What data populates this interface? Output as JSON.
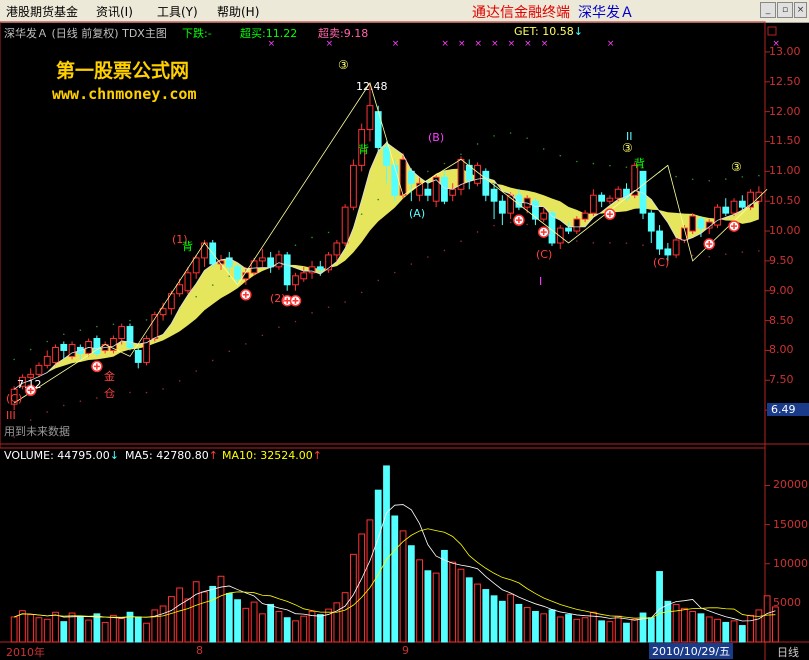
{
  "menu": {
    "items": [
      "港股期货基金",
      "资讯(I)",
      "工具(Y)",
      "帮助(H)"
    ],
    "terminal_name": "通达信金融终端",
    "stock_title": "深华发Ａ"
  },
  "header": {
    "stock": "深华发Ａ",
    "period": "(日线 前复权)",
    "indicator": "TDX主图",
    "xia_die_label": "下跌:",
    "xia_die_value": "-",
    "chao_mai_label": "超买:",
    "chao_mai_value": "11.22",
    "chao_mai2_label": "超卖:",
    "chao_mai2_value": "9.18",
    "get_label": "GET:",
    "get_value": "10.58"
  },
  "watermark": {
    "site_name": "第一股票公式网",
    "site_url": "www.chnmoney.com"
  },
  "price_axis": [
    "13.00",
    "12.50",
    "12.00",
    "11.50",
    "11.00",
    "10.50",
    "10.00",
    "9.50",
    "9.00",
    "8.50",
    "8.00",
    "7.50",
    "7.00"
  ],
  "current_price_tag": "6.49",
  "annotations": {
    "peak_value": "12.48",
    "low_value": "7.12",
    "circle3": "③",
    "wave_1": "(1)",
    "wave_2": "(2)",
    "wave_A": "(A)",
    "wave_B": "(B)",
    "wave_C": "(C)",
    "wave_I": "I",
    "wave_II": "II",
    "wave_III": "III",
    "bei": "背",
    "jin": "金",
    "cang": "仓",
    "future_data": "用到未来数据"
  },
  "volume_header": {
    "volume_label": "VOLUME:",
    "volume_value": "44795.00",
    "ma5_label": "MA5:",
    "ma5_value": "42780.80",
    "ma10_label": "MA10:",
    "ma10_value": "32524.00"
  },
  "volume_axis": [
    "20000",
    "15000",
    "10000",
    "5000"
  ],
  "date_axis": {
    "year": "2010年",
    "m8": "8",
    "m9": "9",
    "current_date": "2010/10/29/五",
    "period_tab": "日线"
  },
  "colors": {
    "up": "#ff3232",
    "down": "#54ffff",
    "ma5": "#ffffff",
    "ma10": "#ffff00",
    "band": "#ffff66",
    "axis": "#b22222"
  },
  "chart_data": {
    "type": "candlestick",
    "candles": [
      {
        "o": 7.1,
        "c": 7.35,
        "h": 7.4,
        "l": 7.0
      },
      {
        "o": 7.4,
        "c": 7.55,
        "h": 7.6,
        "l": 7.35
      },
      {
        "o": 7.55,
        "c": 7.6,
        "h": 7.7,
        "l": 7.5
      },
      {
        "o": 7.6,
        "c": 7.75,
        "h": 7.8,
        "l": 7.55
      },
      {
        "o": 7.75,
        "c": 7.9,
        "h": 8.0,
        "l": 7.7
      },
      {
        "o": 7.8,
        "c": 8.05,
        "h": 8.1,
        "l": 7.75
      },
      {
        "o": 8.1,
        "c": 8.0,
        "h": 8.15,
        "l": 7.85
      },
      {
        "o": 7.9,
        "c": 8.1,
        "h": 8.15,
        "l": 7.85
      },
      {
        "o": 8.05,
        "c": 7.95,
        "h": 8.1,
        "l": 7.85
      },
      {
        "o": 7.95,
        "c": 8.15,
        "h": 8.2,
        "l": 7.9
      },
      {
        "o": 8.2,
        "c": 7.95,
        "h": 8.25,
        "l": 7.9
      },
      {
        "o": 8.0,
        "c": 8.1,
        "h": 8.15,
        "l": 7.95
      },
      {
        "o": 8.0,
        "c": 8.2,
        "h": 8.25,
        "l": 7.95
      },
      {
        "o": 8.2,
        "c": 8.4,
        "h": 8.45,
        "l": 8.1
      },
      {
        "o": 8.4,
        "c": 8.05,
        "h": 8.45,
        "l": 8.0
      },
      {
        "o": 8.0,
        "c": 7.8,
        "h": 8.05,
        "l": 7.7
      },
      {
        "o": 7.8,
        "c": 8.2,
        "h": 8.25,
        "l": 7.75
      },
      {
        "o": 8.2,
        "c": 8.6,
        "h": 8.65,
        "l": 8.15
      },
      {
        "o": 8.6,
        "c": 8.7,
        "h": 8.8,
        "l": 8.5
      },
      {
        "o": 8.7,
        "c": 8.95,
        "h": 9.0,
        "l": 8.6
      },
      {
        "o": 8.95,
        "c": 9.1,
        "h": 9.2,
        "l": 8.9
      },
      {
        "o": 9.0,
        "c": 9.3,
        "h": 9.4,
        "l": 8.95
      },
      {
        "o": 9.3,
        "c": 9.55,
        "h": 9.6,
        "l": 9.2
      },
      {
        "o": 9.55,
        "c": 9.8,
        "h": 9.85,
        "l": 9.4
      },
      {
        "o": 9.8,
        "c": 9.45,
        "h": 9.85,
        "l": 9.4
      },
      {
        "o": 9.45,
        "c": 9.5,
        "h": 9.6,
        "l": 9.35
      },
      {
        "o": 9.55,
        "c": 9.4,
        "h": 9.65,
        "l": 9.3
      },
      {
        "o": 9.4,
        "c": 9.2,
        "h": 9.45,
        "l": 9.1
      },
      {
        "o": 9.2,
        "c": 9.3,
        "h": 9.4,
        "l": 9.1
      },
      {
        "o": 9.3,
        "c": 9.5,
        "h": 9.55,
        "l": 9.25
      },
      {
        "o": 9.5,
        "c": 9.55,
        "h": 9.7,
        "l": 9.4
      },
      {
        "o": 9.55,
        "c": 9.4,
        "h": 9.65,
        "l": 9.3
      },
      {
        "o": 9.4,
        "c": 9.6,
        "h": 9.65,
        "l": 9.35
      },
      {
        "o": 9.6,
        "c": 9.1,
        "h": 9.65,
        "l": 9.0
      },
      {
        "o": 9.1,
        "c": 9.25,
        "h": 9.3,
        "l": 9.0
      },
      {
        "o": 9.2,
        "c": 9.3,
        "h": 9.4,
        "l": 9.15
      },
      {
        "o": 9.3,
        "c": 9.4,
        "h": 9.5,
        "l": 9.2
      },
      {
        "o": 9.4,
        "c": 9.35,
        "h": 9.5,
        "l": 9.25
      },
      {
        "o": 9.35,
        "c": 9.6,
        "h": 9.65,
        "l": 9.3
      },
      {
        "o": 9.6,
        "c": 9.8,
        "h": 9.85,
        "l": 9.5
      },
      {
        "o": 9.8,
        "c": 10.4,
        "h": 10.45,
        "l": 9.75
      },
      {
        "o": 10.4,
        "c": 11.1,
        "h": 11.2,
        "l": 10.35
      },
      {
        "o": 11.1,
        "c": 11.7,
        "h": 11.8,
        "l": 11.0
      },
      {
        "o": 11.7,
        "c": 12.1,
        "h": 12.48,
        "l": 11.5
      },
      {
        "o": 12.0,
        "c": 11.4,
        "h": 12.1,
        "l": 11.3
      },
      {
        "o": 11.4,
        "c": 11.1,
        "h": 11.5,
        "l": 10.8
      },
      {
        "o": 11.1,
        "c": 10.6,
        "h": 11.2,
        "l": 10.5
      },
      {
        "o": 10.6,
        "c": 11.2,
        "h": 11.3,
        "l": 10.55
      },
      {
        "o": 11.0,
        "c": 10.8,
        "h": 11.05,
        "l": 10.5
      },
      {
        "o": 10.6,
        "c": 10.8,
        "h": 10.9,
        "l": 10.5
      },
      {
        "o": 10.7,
        "c": 10.6,
        "h": 10.85,
        "l": 10.5
      },
      {
        "o": 10.5,
        "c": 10.9,
        "h": 10.95,
        "l": 10.4
      },
      {
        "o": 10.9,
        "c": 10.5,
        "h": 11.0,
        "l": 10.45
      },
      {
        "o": 10.6,
        "c": 10.7,
        "h": 10.8,
        "l": 10.5
      },
      {
        "o": 10.7,
        "c": 11.2,
        "h": 11.25,
        "l": 10.6
      },
      {
        "o": 11.1,
        "c": 10.85,
        "h": 11.2,
        "l": 10.7
      },
      {
        "o": 10.8,
        "c": 11.1,
        "h": 11.15,
        "l": 10.75
      },
      {
        "o": 11.0,
        "c": 10.6,
        "h": 11.05,
        "l": 10.5
      },
      {
        "o": 10.7,
        "c": 10.5,
        "h": 10.8,
        "l": 10.2
      },
      {
        "o": 10.5,
        "c": 10.3,
        "h": 10.6,
        "l": 10.1
      },
      {
        "o": 10.3,
        "c": 10.6,
        "h": 10.65,
        "l": 10.2
      },
      {
        "o": 10.6,
        "c": 10.4,
        "h": 10.7,
        "l": 10.35
      },
      {
        "o": 10.4,
        "c": 10.55,
        "h": 10.6,
        "l": 10.3
      },
      {
        "o": 10.5,
        "c": 10.2,
        "h": 10.55,
        "l": 10.1
      },
      {
        "o": 10.2,
        "c": 10.3,
        "h": 10.4,
        "l": 10.15
      },
      {
        "o": 10.3,
        "c": 9.8,
        "h": 10.35,
        "l": 9.75
      },
      {
        "o": 9.8,
        "c": 10.05,
        "h": 10.1,
        "l": 9.7
      },
      {
        "o": 10.05,
        "c": 10.0,
        "h": 10.15,
        "l": 9.95
      },
      {
        "o": 10.0,
        "c": 10.2,
        "h": 10.25,
        "l": 9.95
      },
      {
        "o": 10.2,
        "c": 10.3,
        "h": 10.35,
        "l": 10.15
      },
      {
        "o": 10.3,
        "c": 10.6,
        "h": 10.7,
        "l": 10.25
      },
      {
        "o": 10.6,
        "c": 10.5,
        "h": 10.65,
        "l": 10.4
      },
      {
        "o": 10.5,
        "c": 10.55,
        "h": 10.6,
        "l": 10.45
      },
      {
        "o": 10.55,
        "c": 10.7,
        "h": 10.75,
        "l": 10.5
      },
      {
        "o": 10.7,
        "c": 10.55,
        "h": 10.8,
        "l": 10.5
      },
      {
        "o": 10.6,
        "c": 11.1,
        "h": 11.15,
        "l": 10.55
      },
      {
        "o": 11.0,
        "c": 10.3,
        "h": 11.0,
        "l": 10.2
      },
      {
        "o": 10.3,
        "c": 10.0,
        "h": 10.35,
        "l": 9.8
      },
      {
        "o": 10.0,
        "c": 9.7,
        "h": 10.1,
        "l": 9.6
      },
      {
        "o": 9.7,
        "c": 9.6,
        "h": 9.8,
        "l": 9.5
      },
      {
        "o": 9.6,
        "c": 9.85,
        "h": 9.9,
        "l": 9.55
      },
      {
        "o": 9.85,
        "c": 10.05,
        "h": 10.1,
        "l": 9.8
      },
      {
        "o": 10.0,
        "c": 10.25,
        "h": 10.3,
        "l": 9.95
      },
      {
        "o": 10.2,
        "c": 10.05,
        "h": 10.25,
        "l": 9.9
      },
      {
        "o": 10.05,
        "c": 10.15,
        "h": 10.2,
        "l": 9.95
      },
      {
        "o": 10.1,
        "c": 10.4,
        "h": 10.45,
        "l": 10.05
      },
      {
        "o": 10.4,
        "c": 10.3,
        "h": 10.55,
        "l": 10.25
      },
      {
        "o": 10.3,
        "c": 10.5,
        "h": 10.55,
        "l": 10.25
      },
      {
        "o": 10.5,
        "c": 10.4,
        "h": 10.6,
        "l": 10.35
      },
      {
        "o": 10.4,
        "c": 10.65,
        "h": 10.7,
        "l": 10.35
      },
      {
        "o": 10.5,
        "c": 10.65,
        "h": 10.75,
        "l": 10.45
      }
    ],
    "volume": [
      3200,
      4000,
      3500,
      3100,
      2900,
      3800,
      2600,
      3700,
      3300,
      2800,
      3600,
      2500,
      3400,
      3000,
      3800,
      3200,
      2400,
      4100,
      4600,
      5800,
      6900,
      5500,
      7700,
      6400,
      7100,
      8400,
      6200,
      5400,
      4300,
      5100,
      3600,
      4800,
      3900,
      3100,
      2700,
      3300,
      3900,
      3500,
      4200,
      5000,
      6300,
      11200,
      13800,
      15600,
      19400,
      22500,
      16100,
      14200,
      12300,
      10500,
      9100,
      8800,
      11700,
      10200,
      9300,
      8200,
      7400,
      6700,
      5900,
      5200,
      6100,
      4800,
      4400,
      3900,
      3600,
      4100,
      3200,
      3500,
      2900,
      3100,
      3800,
      2700,
      2600,
      3300,
      2400,
      2900,
      3700,
      3100,
      9000,
      5200,
      4800,
      4300,
      3900,
      3600,
      3200,
      2900,
      2500,
      2700,
      2100,
      3400,
      4100,
      5900,
      4480
    ],
    "ylim": [
      6.5,
      13.2
    ],
    "vol_ylim": [
      0,
      23000
    ]
  }
}
